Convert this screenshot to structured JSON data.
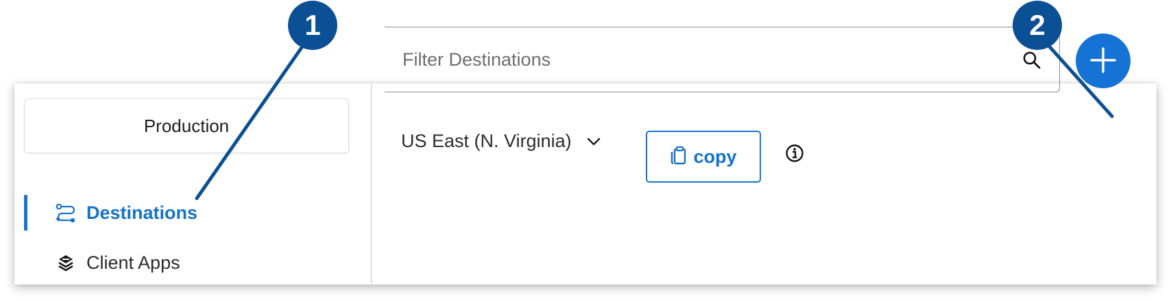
{
  "sidebar": {
    "environment_label": "Production",
    "items": [
      {
        "label": "Destinations",
        "icon": "route-icon",
        "active": true
      },
      {
        "label": "Client Apps",
        "icon": "apps-icon",
        "active": false
      }
    ]
  },
  "main": {
    "search": {
      "placeholder": "Filter Destinations",
      "value": ""
    },
    "add_button_icon": "plus-icon",
    "region": {
      "selected": "US East (N. Virginia)"
    },
    "copy_label": "copy",
    "info_icon": "info-icon"
  },
  "callouts": [
    "1",
    "2"
  ],
  "colors": {
    "accent": "#1473d4",
    "callout": "#0b4f95",
    "active_text": "#1572c9"
  }
}
